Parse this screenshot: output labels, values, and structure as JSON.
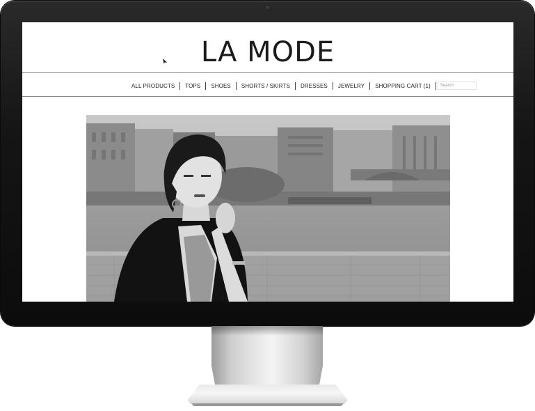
{
  "site": {
    "logo": "LA MODE",
    "nav": {
      "items": [
        {
          "label": "All Products"
        },
        {
          "label": "Tops"
        },
        {
          "label": "Shoes"
        },
        {
          "label": "Shorts / Skirts"
        },
        {
          "label": "Dresses"
        },
        {
          "label": "Jewelry"
        },
        {
          "label": "Shopping Cart (1)"
        }
      ],
      "search_placeholder": "Search"
    },
    "hero_image": "black-and-white fashion photo of a woman by a river railing"
  },
  "colors": {
    "monitor_bezel": "#141414",
    "stand": "#d8d8d8",
    "nav_text": "#222222",
    "logo_text": "#1b1b1b"
  }
}
